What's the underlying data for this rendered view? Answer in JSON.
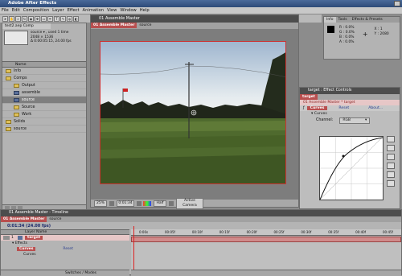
{
  "app": {
    "title": "Adobe After Effects"
  },
  "menu": [
    "File",
    "Edit",
    "Composition",
    "Layer",
    "Effect",
    "Animation",
    "View",
    "Window",
    "Help"
  ],
  "project": {
    "tab_label": "test2.aep Comp",
    "name_header": "Name",
    "preview_name": "source ▾ , used 1 time",
    "preview_info_1": "2048 × 1536",
    "preview_info_2": "Δ 0:00:05:15, 24.00 fps",
    "items": [
      {
        "label": "Info",
        "type": "folder"
      },
      {
        "label": "Comps",
        "type": "folder"
      },
      {
        "label": "Output",
        "type": "folder"
      },
      {
        "label": "assemble",
        "type": "comp"
      },
      {
        "label": "source",
        "type": "comp"
      },
      {
        "label": "Source",
        "type": "folder"
      },
      {
        "label": "Work",
        "type": "folder"
      },
      {
        "label": "Solids",
        "type": "folder"
      },
      {
        "label": "source",
        "type": "footage"
      }
    ]
  },
  "comp_window": {
    "title": "01 Assemble Master",
    "tab_main": "01 Assemble Master",
    "tab_second": "source",
    "zoom": "25%",
    "timecode": "0:01:34",
    "resolution": "Half",
    "camera": "Active Camera"
  },
  "info_panel": {
    "tabs": [
      "Info",
      "Tools",
      "Effects & Presets"
    ],
    "r_label": "R",
    "r_value": "0.0%",
    "g_label": "G",
    "g_value": "0.0%",
    "b_label": "B",
    "b_value": "0.0%",
    "a_label": "A",
    "a_value": "0.0%",
    "x_label": "X",
    "x_value": "1",
    "y_label": "Y",
    "y_value": "2080"
  },
  "effect_controls": {
    "title": "target : Effect Controls",
    "tab_label": "target",
    "layer_path": "01 Assemble Master * target",
    "effect_name": "Curves",
    "reset_label": "Reset",
    "about_label": "About...",
    "curves_sub": "Curves",
    "channel_label": "Channel:",
    "channel_value": "RGB"
  },
  "timeline": {
    "window_title": "01 Assemble Master - Timeline",
    "tab_main": "01 Assemble Master",
    "tab_second": "source",
    "timecode": "0:01:34 (24.00 fps)",
    "layer_name_header": "Layer Name",
    "layer_number": "1",
    "layer_name": "target",
    "effects_label": "Effects",
    "effect_row": "Curves",
    "reset_label": "Reset",
    "curves_row": "Curves",
    "footer_label": "Switches / Modes",
    "ruler_ticks": [
      "0:00s",
      "00:05f",
      "00:10f",
      "00:15f",
      "00:20f",
      "00:25f",
      "00:30f",
      "00:35f",
      "00:40f",
      "00:45f"
    ]
  },
  "colors": {
    "red_accent": "#b94f4f",
    "panel_gray": "#b3b3b3",
    "title_blue": "#2d4a78"
  }
}
